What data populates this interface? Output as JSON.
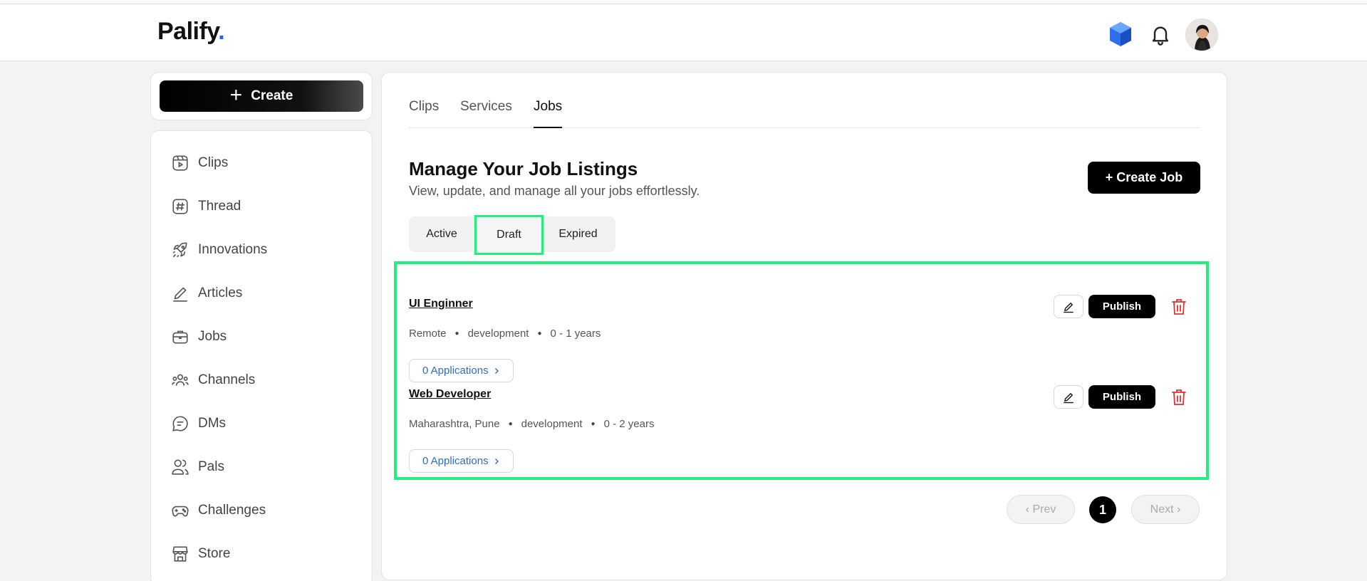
{
  "app": {
    "logo_text": "Palify",
    "logo_dot": "."
  },
  "sidebar": {
    "create_label": "Create",
    "items": [
      {
        "label": "Clips",
        "icon": "clips-icon"
      },
      {
        "label": "Thread",
        "icon": "hash-icon"
      },
      {
        "label": "Innovations",
        "icon": "rocket-icon"
      },
      {
        "label": "Articles",
        "icon": "pen-icon"
      },
      {
        "label": "Jobs",
        "icon": "briefcase-icon"
      },
      {
        "label": "Channels",
        "icon": "users-group-icon"
      },
      {
        "label": "DMs",
        "icon": "chat-icon"
      },
      {
        "label": "Pals",
        "icon": "users-icon"
      },
      {
        "label": "Challenges",
        "icon": "gamepad-icon"
      },
      {
        "label": "Store",
        "icon": "store-icon"
      }
    ]
  },
  "main": {
    "tabs": [
      {
        "label": "Clips",
        "active": false
      },
      {
        "label": "Services",
        "active": false
      },
      {
        "label": "Jobs",
        "active": true
      }
    ],
    "title": "Manage Your Job Listings",
    "subtitle": "View, update, and manage all your jobs effortlessly.",
    "create_job_label": "+ Create Job",
    "status_tabs": [
      {
        "label": "Active",
        "selected": false
      },
      {
        "label": "Draft",
        "selected": true
      },
      {
        "label": "Expired",
        "selected": false
      }
    ],
    "jobs": [
      {
        "title": "UI Enginner",
        "location": "Remote",
        "category": "development",
        "experience": "0 - 1 years",
        "applications_label": "0 Applications",
        "publish_label": "Publish"
      },
      {
        "title": "Web Developer",
        "location": "Maharashtra, Pune",
        "category": "development",
        "experience": "0 - 2 years",
        "applications_label": "0 Applications",
        "publish_label": "Publish"
      }
    ],
    "pagination": {
      "prev_label": "Prev",
      "current_page": "1",
      "next_label": "Next"
    }
  },
  "colors": {
    "accent_blue": "#2563eb",
    "highlight_green": "#22f07d",
    "delete_red": "#e03131",
    "link_blue": "#2f6cc9"
  }
}
